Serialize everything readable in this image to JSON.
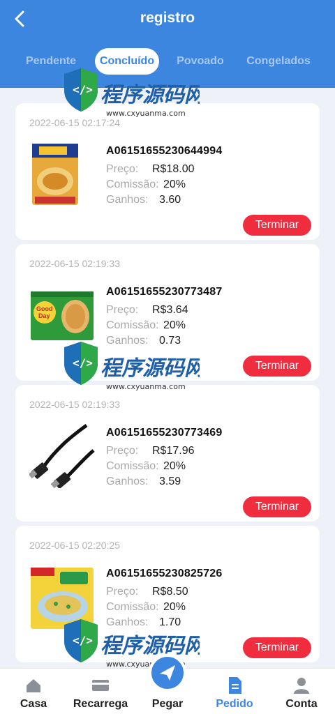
{
  "header": {
    "back_icon": "chevron-left-icon",
    "title": "registro"
  },
  "tabs": [
    {
      "label": "Pendente",
      "active": false
    },
    {
      "label": "Concluído",
      "active": true
    },
    {
      "label": "Povoado",
      "active": false
    },
    {
      "label": "Congelados",
      "active": false
    }
  ],
  "labels": {
    "price": "Preço:",
    "commission": "Comissão:",
    "earnings": "Ganhos:",
    "button": "Terminar"
  },
  "orders": [
    {
      "date": "2022-06-15 02:17:24",
      "id": "A06151655230644994",
      "price": "R$18.00",
      "commission": "20%",
      "earnings": "3.60",
      "image": "pasta-packet"
    },
    {
      "date": "2022-06-15 02:19:33",
      "id": "A06151655230773487",
      "price": "R$3.64",
      "commission": "20%",
      "earnings": "0.73",
      "image": "biscuit-packet"
    },
    {
      "date": "2022-06-15 02:19:33",
      "id": "A06151655230773469",
      "price": "R$17.96",
      "commission": "20%",
      "earnings": "3.59",
      "image": "hdmi-cable"
    },
    {
      "date": "2022-06-15 02:20:25",
      "id": "A06151655230825726",
      "price": "R$8.50",
      "commission": "20%",
      "earnings": "1.70",
      "image": "noodle-packet"
    }
  ],
  "watermark": {
    "text": "程序源码网",
    "url": "www.cxyuanma.com"
  },
  "bottom_nav": [
    {
      "label": "Casa",
      "icon": "home-icon",
      "active": false
    },
    {
      "label": "Recarrega",
      "icon": "card-icon",
      "active": false
    },
    {
      "label": "Pegar",
      "icon": "send-icon",
      "active": false
    },
    {
      "label": "Pedido",
      "icon": "document-icon",
      "active": true
    },
    {
      "label": "Conta",
      "icon": "user-icon",
      "active": false
    }
  ],
  "colors": {
    "primary": "#3d86e0",
    "button": "#ef2d3f"
  }
}
